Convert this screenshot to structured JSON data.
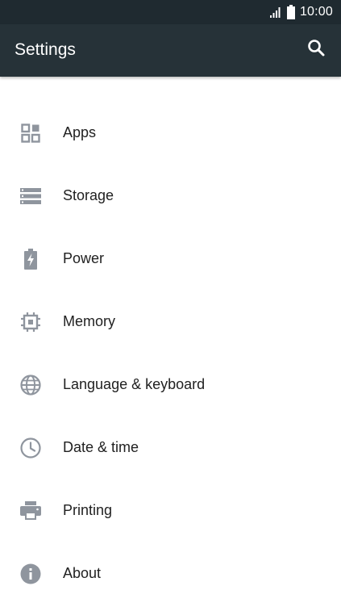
{
  "status_bar": {
    "time": "10:00",
    "icons": [
      "signal-icon",
      "battery-icon"
    ]
  },
  "app_bar": {
    "title": "Settings",
    "search_icon": "search-icon"
  },
  "colors": {
    "status_bar": "#1f2a30",
    "app_bar": "#263238",
    "icon": "#8f959e",
    "text": "#212121"
  },
  "partial_item": {
    "icon": "settings-item-icon"
  },
  "items": [
    {
      "label": "Apps",
      "icon": "apps-grid-icon"
    },
    {
      "label": "Storage",
      "icon": "storage-icon"
    },
    {
      "label": "Power",
      "icon": "battery-charging-icon"
    },
    {
      "label": "Memory",
      "icon": "memory-chip-icon"
    },
    {
      "label": "Language & keyboard",
      "icon": "globe-icon"
    },
    {
      "label": "Date & time",
      "icon": "clock-icon"
    },
    {
      "label": "Printing",
      "icon": "printer-icon"
    },
    {
      "label": "About",
      "icon": "info-icon"
    }
  ]
}
